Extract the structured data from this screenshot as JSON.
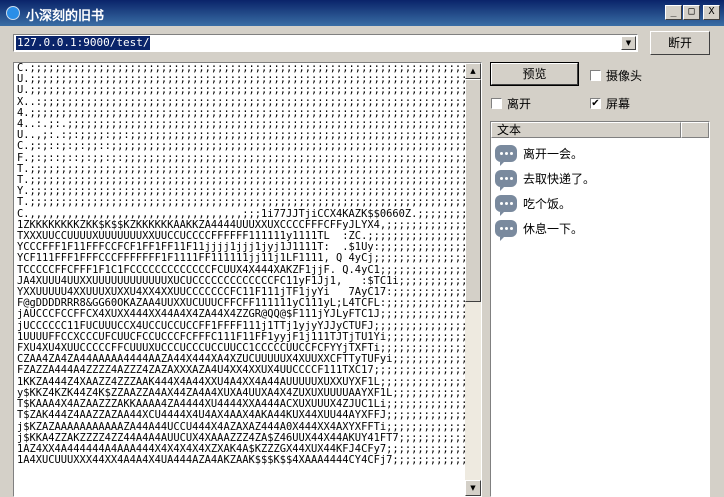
{
  "window": {
    "title": "小深刻的旧书",
    "minimize_glyph": "_",
    "maximize_glyph": "□",
    "close_glyph": "X"
  },
  "toolbar": {
    "url_value": "127.0.0.1:9000/test/",
    "disconnect_label": "断开"
  },
  "controls": {
    "preview_label": "预览",
    "camera_label": "摄像头",
    "camera_checked": false,
    "leave_label": "离开",
    "leave_checked": false,
    "screen_label": "屏幕",
    "screen_checked": true
  },
  "ascii_view": {
    "lines": [
      "C.;;;;;;;;;;;;;;;;;;;;;;;;;;;;;;;;;;;;;;;;;;;;;;;;;;;;;;;;;;;;;;;;;;;;;;",
      "U.;;;;;;;;;;;;;;;;;;;;;;;;;;;;;;;;;;;;;;;;;;;;;;;;;;;;;;;;;;;;;;;;;;;;;;",
      "U.;;;;;;;;;;;;;;;;;;;;;;;;;;;;;;;;;;;;;;;;;;;;;;;;;;;;;;;;;;;;;;;;;;;;;;",
      "X..:;;;;;;;;;;;;;;;;;;;;;;;;;;;;;;;;;;;;;;;;;;;;;;;;;;;;;;;;;;;;;;;;;;;;",
      "4.;;;;;;;;;;;;;;;;;;;;;;;;;;;;;;;;;;;;;;;;;;;;;;;;;;;;;;;;;;;;;;;;;;;;;;",
      "4..:.;:.;;;;;;;;;;;;;;;;;;;;;;;;;;;;;;;;;;;;;;;;;;;;;;;;;;;;;;;;;;;;;;;;",
      "U..,;:.:;:;;;;:;;:;;;;;;;;;;;;;;;;;;;;;;;;;;;;;;;;;;;;;;;;;;;;;;;;;;;;;;",
      "C.;:;::;:;:;;::;;;;;;;;;;;;;;;;;;;;;;;;;;;;;;;;;;;;;;;;;;;;;;;;;;;;;;;;;",
      "F.;:;::;::;:;;:;:;;;;;;;;;;;;;;;;;;;;;;;;;;;;;;;;;;;;;;;;;;;;;;;;;;;;;;;",
      "T.;;;;;;;;;;;;;;;;;;;;;;;;;;;;;;;;;;;;;;;;;;;;;;;;;;;;;;;;;;;;;;;;;;;;;;",
      "T.;;;;;;;;;;;;;;;;;;;;;;;;;;;;;;;;;;;;;;;;;;;;;;;;;;;;;;;;;;;;;;;;;;;;;;",
      "Y.;;;;;;;;;;;;;;;;;;;;;;;;;;;;;;;;;;;;;;;;;;;;;;;;;;;;;;;;;;;;;;;;;;;;;;",
      "T.;;;;;;;;;;;;;;;;;;;;;;;;;;;;;;;;;;;;;;;;;;;;;;;;;;;;;;;;;;;;;;;;;;;;;;",
      "C.,,,,,,,,,,,,,,,,,,,,,,,,,,,,,,,,,,;;;1i77JJTjiCCX4KAZK$$0660Z.;;;;;;;;",
      "1ZKKKKKKKKZKK$K$$KZKKKKKKAAKKZA4444UUUXXUXCCCCFFFCFFyJLYX4,;;;;;;;;;;;;;",
      "TXXXUUCCUUUUXUUUUUUUXXUUCCUCCCCFFFFFF111111y1111TL  :ZC.;;;;;;;;;;;;;;;;",
      "YCCCFFF1F11FFFCCFCF1FF1FF11F11jjjj1jjj1jyj1J1111T:  .$1Uy:;;;;;;;;;;;;;;",
      "YCF111FFF1FFFCCCFFFFFFF1F1111FF111111jj11j1LF1111, Q 4yCj;;;;;;;;;;;;;;;",
      "TCCCCCFFCFFF1F1C1FCCCCCCCCCCCCCFCUUX4X444XAKZF1jjF. Q.4yC1;;;;;;;;;;;;;;",
      "JA4XUUU4UUXXUUUUUUUUUUUUXUCUCCCCCCCCCCCCCFC11yF1Jj1,   :$TC1i;;;;;;;;;;;",
      "YXXUUUUU4XXUUUXUXXU4XX4XXUUCCCCCCCFC11F111jTF1jyYi   7AyC17:;;;;;;;;;;;;",
      "F@gDDDDRRR8&GG60OKAZAA4UUXXUCUUUCFFCFF111111yC111yL;L4TCFL:;;;;;;;;;;;;;",
      "jAUCCCFCCFFCX4XUXX444XX44A4X4ZA44X4ZZGR@QQ@$F111jYJLyFTC1J;;;;;;;;;;;;;;",
      "jUCCCCCC11FUCUUUCCX4UCCUCCUCCFF1FFFF111j1TTj1yjyYJJyCTUFJ;;;;;;;;;;;;;;;",
      "1UUUUFFCCXCCCUFCUUCFCCUCCCFCFFFC111F11FF1yyjF1j111TJTjTU1Yi;;;;;;;;;;;;;",
      "FXU4XU4XUUCCCCCFFCUUUXUCCCUCCCUCCUUCC1CCCCCUUCCFCFYYjTXFTi;;;;;;;;;;;;;;",
      "CZAA4ZA4ZA44AAAAA4444AAZA44X444XA4XZUCUUUUUX4XUUXXCFTTyTUFyi;;;;;;;;;;;;",
      "FZAZZA444A4ZZZZ4AZZZ4ZAZAXXXAZA4U4XX4XXUX4UUCCCCF111TXC17;;;;;;;;;;;;;;;",
      "1KKZA444Z4XAAZZ4ZZZAAK444X4A44XXU4A4XX4A44AUUUUUXUXXUYXF1L;;;;;;;;;;;;;;",
      "y$KKZ4KZK44Z4K$ZZAAZZA4AX44ZA4A4XUXA4UUXA4X4ZUXUXUUUUAAYXF1L;;;;;;;;;;;;",
      "T$KAAA4X4AZAAZZZAKKAAAA4ZA4444XU4444XXA444ACXUXUUUX4ZJUC1Li;;;;;;;;;;;;;",
      "T$ZAK444Z4AAZZAZAA44XCU4444X4U4AX4AAX4AKA44KUX44XUU44AYXFFJ;;;;;;;;;;;;;",
      "j$KZAZAAAAAAAAAAAZA44A44UCCU444X4AZAXAZ444A0X444XX4AXYXFFTi;;;;;;;;;;;;;",
      "j$KKA4ZZAKZZZZ4ZZ44A4A4AUUCUX4XAAAZZZ4ZA$Z46UUX44X44AKUY41FT7;;;;;;;;;;;",
      "1AZ4XX4A444444A4AAA444X4X4X4X4XZXAK4A$KZZZGX44XUX44KFJ4CFy7;;;;;;;;;;;;;",
      "1A4XUCUUUXXX44XX4A4A4X4UA444AZA4AKZAAK$$$K$$4XAAA4444CY4CFj7;;;;;;;;;;;;"
    ]
  },
  "message_list": {
    "column_header": "文本",
    "items": [
      {
        "text": "离开一会。"
      },
      {
        "text": "去取快递了。"
      },
      {
        "text": "吃个饭。"
      },
      {
        "text": "休息一下。"
      }
    ]
  },
  "colors": {
    "title_bar": "#0a246a",
    "face": "#d4d0c8",
    "selection": "#0a246a",
    "bubble_icon": "#7a8a9e"
  }
}
